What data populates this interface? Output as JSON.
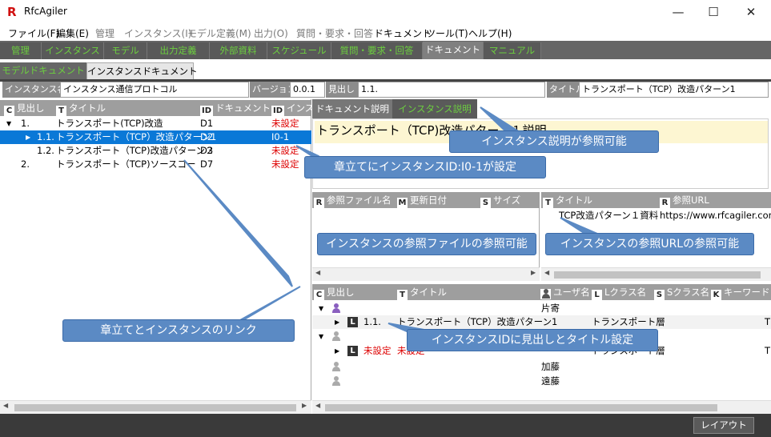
{
  "window": {
    "title": "RfcAgiler",
    "logo": "R",
    "min": "—",
    "max": "☐",
    "close": "✕"
  },
  "menu": [
    "ファイル(F)",
    "編集(E)",
    "管理",
    "インスタンス(I)",
    "モデル定義(M)",
    "出力(O)",
    "質問・要求・回答",
    "ドキュメント",
    "ツール(T)",
    "ヘルプ(H)"
  ],
  "tabs1": [
    "管理",
    "インスタンス",
    "モデル",
    "出力定義",
    "外部資料",
    "スケジュール",
    "質問・要求・回答",
    "ドキュメント",
    "マニュアル"
  ],
  "tabs2": [
    "モデルドキュメント",
    "インスタンスドキュメント"
  ],
  "info": {
    "instance_label": "インスタンス名",
    "instance_value": "インスタンス通信プロトコル",
    "version_label": "バージョン",
    "version_value": "0.0.1",
    "heading_label": "見出し",
    "heading_value": "1.1.",
    "title_label": "タイトル",
    "title_value": "トランスポート（TCP）改造パターン1"
  },
  "left_table": {
    "headers": {
      "c_icon": "C",
      "c": "見出し",
      "t_icon": "T",
      "t": "タイトル",
      "id_icon": "ID",
      "docid": "ドキュメントID",
      "id2_icon": "ID",
      "inst": "インスタ"
    },
    "rows": [
      {
        "toggle": "▼",
        "heading": "1.",
        "title": "トランスポート(TCP)改造",
        "docid": "D1",
        "inst": "未設定"
      },
      {
        "toggle": "▶",
        "heading": "1.1.",
        "title": "トランスポート（TCP）改造パターン1",
        "docid": "D2",
        "inst": "I0-1"
      },
      {
        "toggle": "",
        "heading": "1.2.",
        "title": "トランスポート（TCP)改造パターン２",
        "docid": "D3",
        "inst": "未設定"
      },
      {
        "toggle": "",
        "heading": "2.",
        "title": "トランスポート（TCP)ソースコード内容",
        "docid": "D7",
        "inst": "未設定"
      }
    ]
  },
  "right_tabs": [
    "ドキュメント説明",
    "インスタンス説明"
  ],
  "description_text": "トランスポート（TCP)改造パターン１説明",
  "ref_files": {
    "r_icon": "R",
    "r": "参照ファイル名",
    "m_icon": "M",
    "m": "更新日付",
    "s_icon": "S",
    "s": "サイズ"
  },
  "ref_urls": {
    "t_icon": "T",
    "t": "タイトル",
    "r_icon": "R",
    "r": "参照URL",
    "rows": [
      {
        "title": "TCP改造パターン１資料",
        "url": "https://www.rfcagiler.com"
      }
    ]
  },
  "bottom_table": {
    "headers": {
      "c_icon": "C",
      "c": "見出し",
      "t_icon": "T",
      "t": "タイトル",
      "u": "ユーザ名",
      "l_icon": "L",
      "l": "Lクラス名",
      "s_icon": "S",
      "s": "Sクラス名",
      "k_icon": "K",
      "k": "キーワード"
    },
    "rows": [
      {
        "user": "片寄"
      },
      {
        "heading": "1.1.",
        "title": "トランスポート（TCP）改造パターン1",
        "lclass": "トランスポート層",
        "extra": "T"
      },
      {
        "user": ""
      },
      {
        "heading": "未設定",
        "title": "未設定",
        "lclass": "トランスポート層",
        "extra": "T"
      },
      {
        "user": "加藤"
      },
      {
        "user": "遠藤"
      }
    ]
  },
  "callouts": {
    "c1": "インスタンス説明が参照可能",
    "c2": "章立てにインスタンスID:I0-1が設定",
    "c3": "インスタンスの参照ファイルの参照可能",
    "c4": "インスタンスの参照URLの参照可能",
    "c5": "章立てとインスタンスのリンク",
    "c6": "インスタンスIDに見出しとタイトル設定"
  },
  "status": {
    "layout_button": "レイアウト"
  },
  "colors": {
    "tab_text": "#6ccf3f",
    "header_bg": "#9e9e9e",
    "selected_row": "#0a78d7",
    "callout": "#5b8ac4",
    "unset": "#dd0000"
  }
}
